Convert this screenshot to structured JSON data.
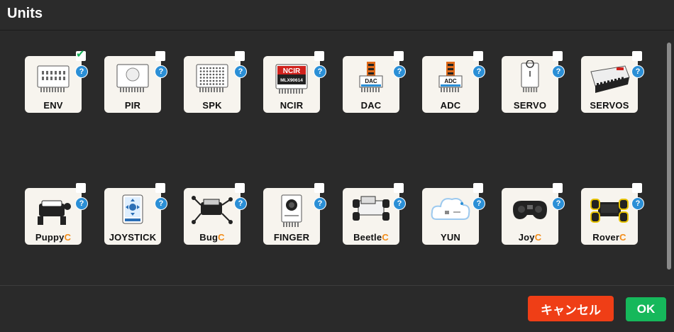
{
  "dialog": {
    "title": "Units",
    "cancel_label": "キャンセル",
    "ok_label": "OK"
  },
  "units": [
    {
      "label": "ENV",
      "suffix": "",
      "checked": true,
      "icon": "env-sensor-icon"
    },
    {
      "label": "PIR",
      "suffix": "",
      "checked": false,
      "icon": "pir-sensor-icon"
    },
    {
      "label": "SPK",
      "suffix": "",
      "checked": false,
      "icon": "speaker-icon"
    },
    {
      "label": "NCIR",
      "suffix": "",
      "checked": false,
      "icon": "ncir-sensor-icon",
      "chip": "NCIR",
      "chip_sub": "MLX90614"
    },
    {
      "label": "DAC",
      "suffix": "",
      "checked": false,
      "icon": "dac-module-icon",
      "chip": "DAC"
    },
    {
      "label": "ADC",
      "suffix": "",
      "checked": false,
      "icon": "adc-module-icon",
      "chip": "ADC"
    },
    {
      "label": "SERVO",
      "suffix": "",
      "checked": false,
      "icon": "servo-icon"
    },
    {
      "label": "SERVOS",
      "suffix": "",
      "checked": false,
      "icon": "servos-board-icon"
    },
    {
      "label": "Puppy",
      "suffix": "C",
      "checked": false,
      "icon": "puppy-robot-icon"
    },
    {
      "label": "JOYSTICK",
      "suffix": "",
      "checked": false,
      "icon": "joystick-icon"
    },
    {
      "label": "Bug",
      "suffix": "C",
      "checked": false,
      "icon": "bug-robot-icon"
    },
    {
      "label": "FINGER",
      "suffix": "",
      "checked": false,
      "icon": "fingerprint-sensor-icon"
    },
    {
      "label": "Beetle",
      "suffix": "C",
      "checked": false,
      "icon": "beetle-car-icon"
    },
    {
      "label": "YUN",
      "suffix": "",
      "checked": false,
      "icon": "yun-cloud-icon"
    },
    {
      "label": "Joy",
      "suffix": "C",
      "checked": false,
      "icon": "joy-controller-icon"
    },
    {
      "label": "Rover",
      "suffix": "C",
      "checked": false,
      "icon": "rover-car-icon"
    }
  ],
  "help_glyph": "?",
  "check_glyph": "✔",
  "colors": {
    "accent_suffix": "#f28c18",
    "cancel_bg": "#ef3e16",
    "ok_bg": "#16b85b",
    "help_bg": "#2b8fd6",
    "card_bg": "#f7f4ee"
  }
}
